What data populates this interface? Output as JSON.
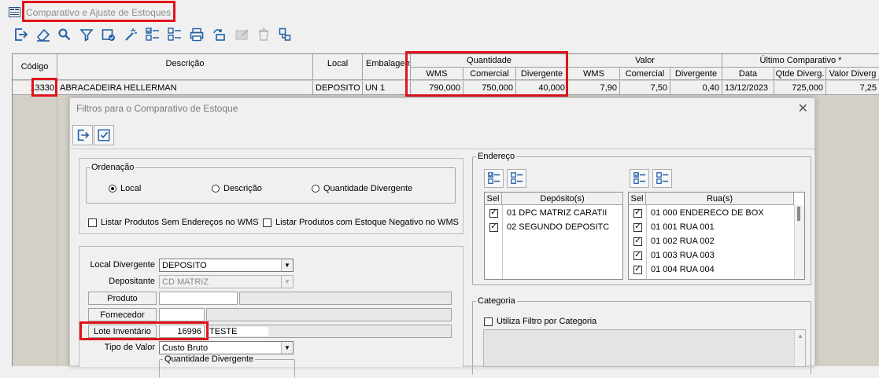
{
  "window": {
    "title": "Comparativo e Ajuste de Estoques"
  },
  "toolbar": {
    "icons": [
      "exit-icon",
      "eraser-icon",
      "search-icon",
      "filter-icon",
      "calendar-check-icon",
      "magic-wand-icon",
      "check-list-icon",
      "uncheck-list-icon",
      "printer-icon",
      "sync-inventory-icon",
      "disabled-edit-icon",
      "disabled-delete-icon",
      "transfer-icon"
    ]
  },
  "grid": {
    "headers": {
      "codigo": "Código",
      "descricao": "Descrição",
      "local": "Local",
      "embalagem": "Embalagem",
      "quantidade": "Quantidade",
      "valor": "Valor",
      "ultimo": "Último Comparativo *",
      "q_wms": "WMS",
      "q_comercial": "Comercial",
      "q_divergente": "Divergente",
      "v_wms": "WMS",
      "v_comercial": "Comercial",
      "v_divergente": "Divergente",
      "u_data": "Data",
      "u_qtde": "Qtde Diverg.",
      "u_valor": "Valor Diverg"
    },
    "row": {
      "codigo": "13330",
      "descricao": "ABRACADEIRA HELLERMAN",
      "local": "DEPOSITO",
      "embalagem": "UN 1",
      "q_wms": "790,000",
      "q_comercial": "750,000",
      "q_divergente": "40,000",
      "v_wms": "7,90",
      "v_comercial": "7,50",
      "v_divergente": "0,40",
      "u_data": "13/12/2023",
      "u_qtde": "725,000",
      "u_valor": "7,25"
    }
  },
  "dialog": {
    "title": "Filtros para o Comparativo de Estoque",
    "close": "✕",
    "ordenacao": {
      "legend": "Ordenação",
      "options": [
        "Local",
        "Descrição",
        "Quantidade Divergente"
      ],
      "selected": "Local"
    },
    "checks": {
      "sem_enderecos": "Listar Produtos Sem Endereços no WMS",
      "estoque_negativo": "Listar Produtos com Estoque Negativo no WMS"
    },
    "fields": {
      "local_divergente_label": "Local Divergente",
      "local_divergente_value": "DEPOSITO",
      "depositante_label": "Depositante",
      "depositante_value": "CD MATRIZ",
      "produto_label": "Produto",
      "fornecedor_label": "Fornecedor",
      "lote_label": "Lote Inventário",
      "lote_value": "16996",
      "lote_desc": "TESTE",
      "tipo_valor_label": "Tipo de Valor",
      "tipo_valor_value": "Custo Bruto",
      "quantidade_divergente_legend": "Quantidade Divergente"
    },
    "endereco": {
      "legend": "Endereço",
      "depositos_headers": {
        "sel": "Sel",
        "name": "Depósito(s)"
      },
      "depositos": [
        {
          "label": "01 DPC MATRIZ CARATII",
          "checked": true
        },
        {
          "label": "02 SEGUNDO DEPOSITC",
          "checked": true
        }
      ],
      "ruas_headers": {
        "sel": "Sel",
        "name": "Rua(s)"
      },
      "ruas": [
        {
          "label": "01 000 ENDERECO DE BOX",
          "checked": true
        },
        {
          "label": "01 001 RUA 001",
          "checked": true
        },
        {
          "label": "01 002 RUA 002",
          "checked": true
        },
        {
          "label": "01 003 RUA 003",
          "checked": true
        },
        {
          "label": "01 004 RUA 004",
          "checked": true
        }
      ]
    },
    "categoria": {
      "legend": "Categoria",
      "utiliza": "Utiliza Filtro por Categoria"
    }
  },
  "colors": {
    "highlight": "#e0141c",
    "grid_bg": "#d4d0c8",
    "accent_blue": "#1f5fa8"
  }
}
